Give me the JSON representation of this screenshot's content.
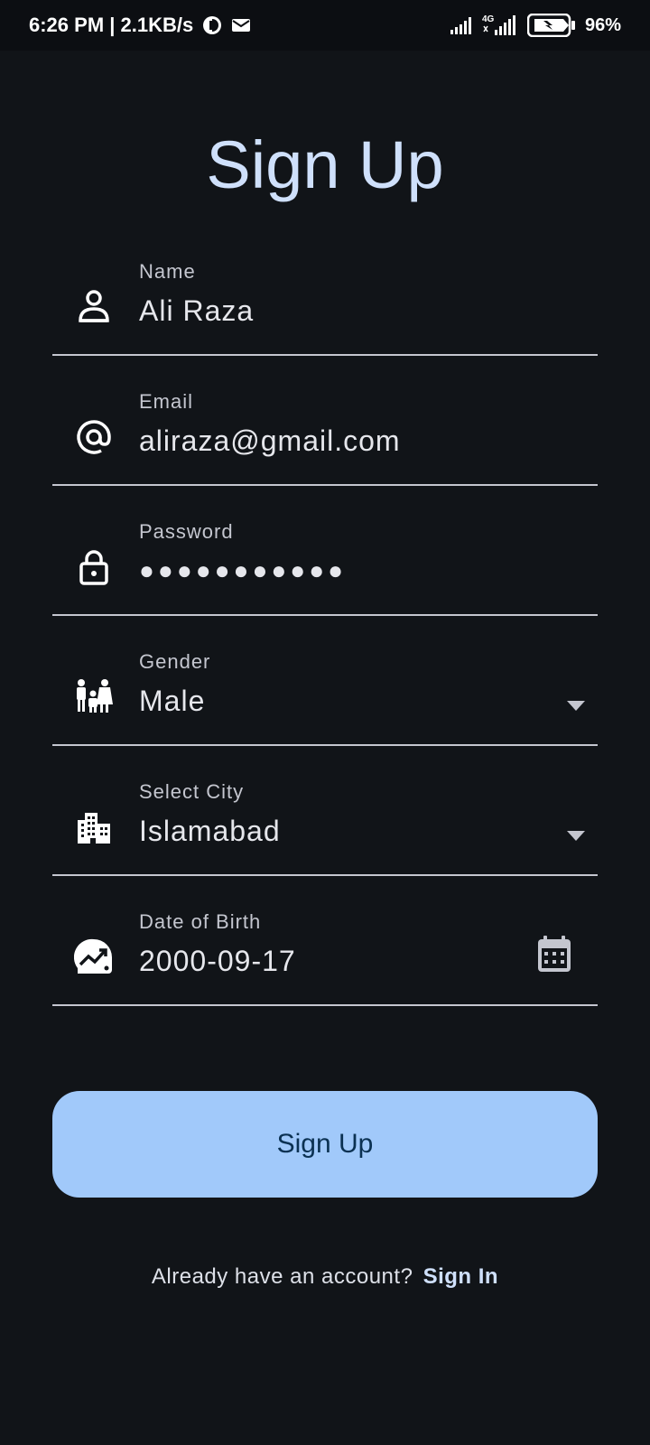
{
  "status_bar": {
    "time_speed": "6:26 PM | 2.1KB/s",
    "network": "4G",
    "battery": "96%"
  },
  "title": "Sign Up",
  "fields": {
    "name": {
      "label": "Name",
      "value": "Ali Raza",
      "icon": "person-icon"
    },
    "email": {
      "label": "Email",
      "value": "aliraza@gmail.com",
      "icon": "at-icon"
    },
    "password": {
      "label": "Password",
      "value": "●●●●●●●●●●●",
      "icon": "lock-icon"
    },
    "gender": {
      "label": "Gender",
      "value": "Male",
      "icon": "family-icon"
    },
    "city": {
      "label": "Select City",
      "value": "Islamabad",
      "icon": "building-icon"
    },
    "dob": {
      "label": "Date of Birth",
      "value": "2000-09-17",
      "icon": "growth-icon"
    }
  },
  "signup_button": "Sign Up",
  "footer": {
    "prompt": "Already have an account?",
    "link": "Sign In"
  },
  "colors": {
    "background": "#111418",
    "accent": "#a1c9fa",
    "title": "#cfe0fb"
  }
}
